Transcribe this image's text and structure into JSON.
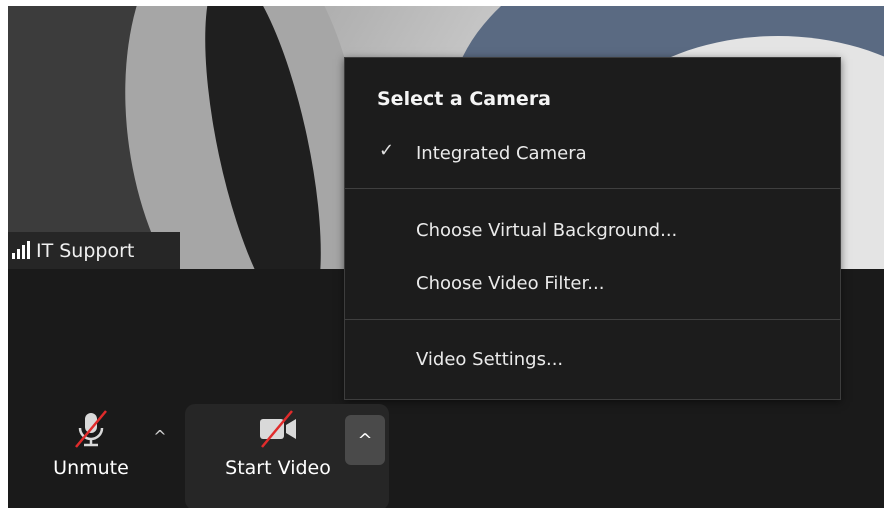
{
  "participant": {
    "name": "IT Support",
    "signal_icon": "signal-bars-icon"
  },
  "camera_menu": {
    "title": "Select a Camera",
    "items": [
      {
        "label": "Integrated Camera",
        "checked": true
      },
      {
        "label": "Choose Virtual Background..."
      },
      {
        "label": "Choose Video Filter..."
      },
      {
        "label": "Video Settings..."
      }
    ]
  },
  "toolbar": {
    "unmute_label": "Unmute",
    "start_video_label": "Start Video",
    "mic_icon": "microphone-muted-icon",
    "camera_icon": "video-camera-off-icon"
  },
  "colors": {
    "panel": "#1c1c1c",
    "mute_slash": "#e02b2b",
    "toolbar_bg": "#1a1a1a"
  }
}
